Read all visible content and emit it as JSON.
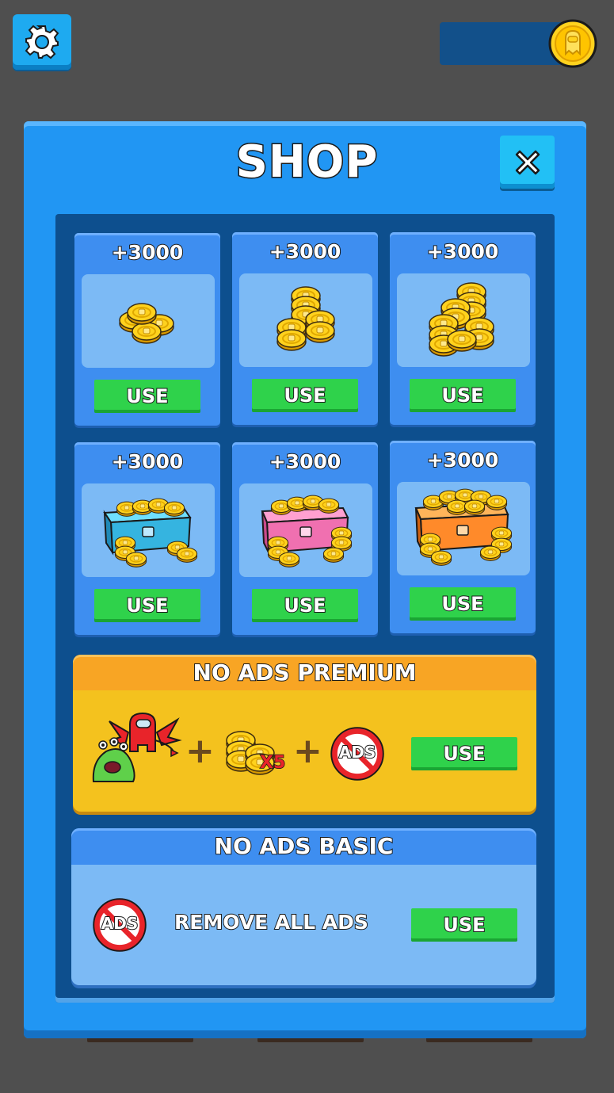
{
  "header": {
    "settings_icon": "gear-icon",
    "coin_balance": "",
    "coin_icon": "ghost-coin-icon"
  },
  "shop": {
    "title": "SHOP",
    "close_icon": "close-icon",
    "coin_packs": [
      {
        "amount": "+3000",
        "button": "USE",
        "image": "small-coin-pile"
      },
      {
        "amount": "+3000",
        "button": "USE",
        "image": "coin-stacks"
      },
      {
        "amount": "+3000",
        "button": "USE",
        "image": "large-coin-stacks"
      },
      {
        "amount": "+3000",
        "button": "USE",
        "image": "blue-treasure-chest"
      },
      {
        "amount": "+3000",
        "button": "USE",
        "image": "pink-treasure-chest"
      },
      {
        "amount": "+3000",
        "button": "USE",
        "image": "orange-treasure-chest"
      }
    ],
    "premium": {
      "title": "NO ADS PREMIUM",
      "multiplier": "X5",
      "ads_label": "ADS",
      "button": "USE"
    },
    "basic": {
      "title": "NO ADS BASIC",
      "ads_label": "ADS",
      "description": "REMOVE ALL ADS",
      "button": "USE"
    }
  },
  "colors": {
    "panel_blue": "#2196f3",
    "inner_navy": "#0d4f8e",
    "button_green": "#2fd24b",
    "premium_gold": "#f4c21e",
    "premium_orange": "#f8a524"
  }
}
